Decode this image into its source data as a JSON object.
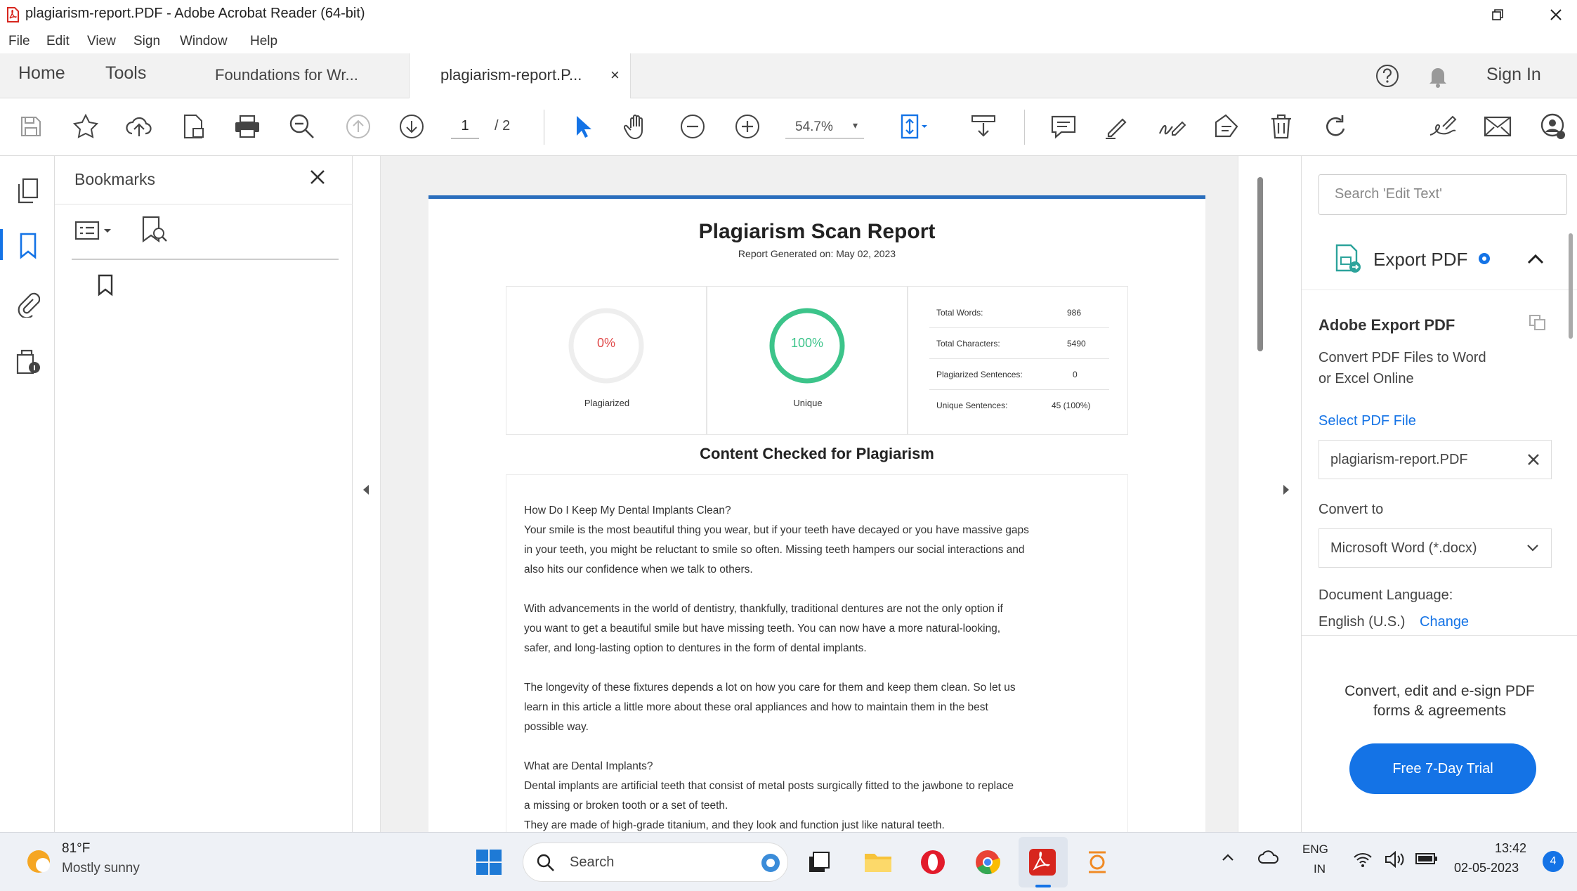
{
  "window": {
    "title": "plagiarism-report.PDF - Adobe Acrobat Reader (64-bit)"
  },
  "menu": [
    "File",
    "Edit",
    "View",
    "Sign",
    "Window",
    "Help"
  ],
  "tabs": {
    "home": "Home",
    "tools": "Tools",
    "doc1": "Foundations for Wr...",
    "doc2": "plagiarism-report.P...",
    "close": "×",
    "sign_in": "Sign In"
  },
  "toolbar": {
    "page_current": "1",
    "page_total": "/ 2",
    "zoom": "54.7%"
  },
  "bookmarks": {
    "title": "Bookmarks"
  },
  "report": {
    "title": "Plagiarism Scan Report",
    "generated": "Report Generated on: May 02, 2023",
    "plagiarized_pct": "0%",
    "plagiarized_label": "Plagiarized",
    "unique_pct": "100%",
    "unique_label": "Unique",
    "stats": [
      {
        "label": "Total Words:",
        "value": "986"
      },
      {
        "label": "Total Characters:",
        "value": "5490"
      },
      {
        "label": "Plagiarized Sentences:",
        "value": "0"
      },
      {
        "label": "Unique Sentences:",
        "value": "45 (100%)"
      }
    ],
    "section_title": "Content Checked for Plagiarism",
    "lines": [
      "How Do I Keep My Dental Implants Clean?",
      "Your smile is the most beautiful thing you wear, but if your teeth have decayed or you have massive gaps",
      "in your teeth, you might be reluctant to smile so often. Missing teeth hampers our social interactions and",
      "also hits our confidence when we talk to others.",
      "",
      "With advancements in the world of dentistry, thankfully, traditional dentures are not the only option if",
      "you want to get a beautiful smile but have missing teeth. You can now have a more natural-looking,",
      "safer, and long-lasting option to dentures in the form of dental implants.",
      "",
      "The longevity of these fixtures depends a lot on how you care for them and keep them clean. So let us",
      "learn in this article a little more about these oral appliances and how to maintain them in the best",
      "possible way.",
      "",
      "What are Dental Implants?",
      "Dental implants are artificial teeth that consist of metal posts surgically fitted to the jawbone to replace",
      "a missing or broken tooth or a set of teeth.",
      "They are made of high-grade titanium, and they look and function just like natural teeth."
    ]
  },
  "rightpanel": {
    "search_placeholder": "Search 'Edit Text'",
    "export_title": "Export PDF",
    "adobe_export": "Adobe Export PDF",
    "desc_line1": "Convert PDF Files to Word",
    "desc_line2": "or Excel Online",
    "select_file": "Select PDF File",
    "file_name": "plagiarism-report.PDF",
    "convert_to": "Convert to",
    "format": "Microsoft Word (*.docx)",
    "doc_lang": "Document Language:",
    "lang_value": "English (U.S.)",
    "change": "Change",
    "promo_line1": "Convert, edit and e-sign PDF",
    "promo_line2": "forms & agreements",
    "trial_button": "Free 7-Day Trial"
  },
  "taskbar": {
    "weather_temp": "81°F",
    "weather_desc": "Mostly sunny",
    "search": "Search",
    "lang1": "ENG",
    "lang2": "IN",
    "time": "13:42",
    "date": "02-05-2023",
    "notif": "4"
  },
  "colors": {
    "accent_blue": "#2a6ebd",
    "unique_green": "#3cc48a",
    "plag_red": "#e04848",
    "trial_blue": "#1473e6",
    "acrobat_red": "#d7261e"
  }
}
